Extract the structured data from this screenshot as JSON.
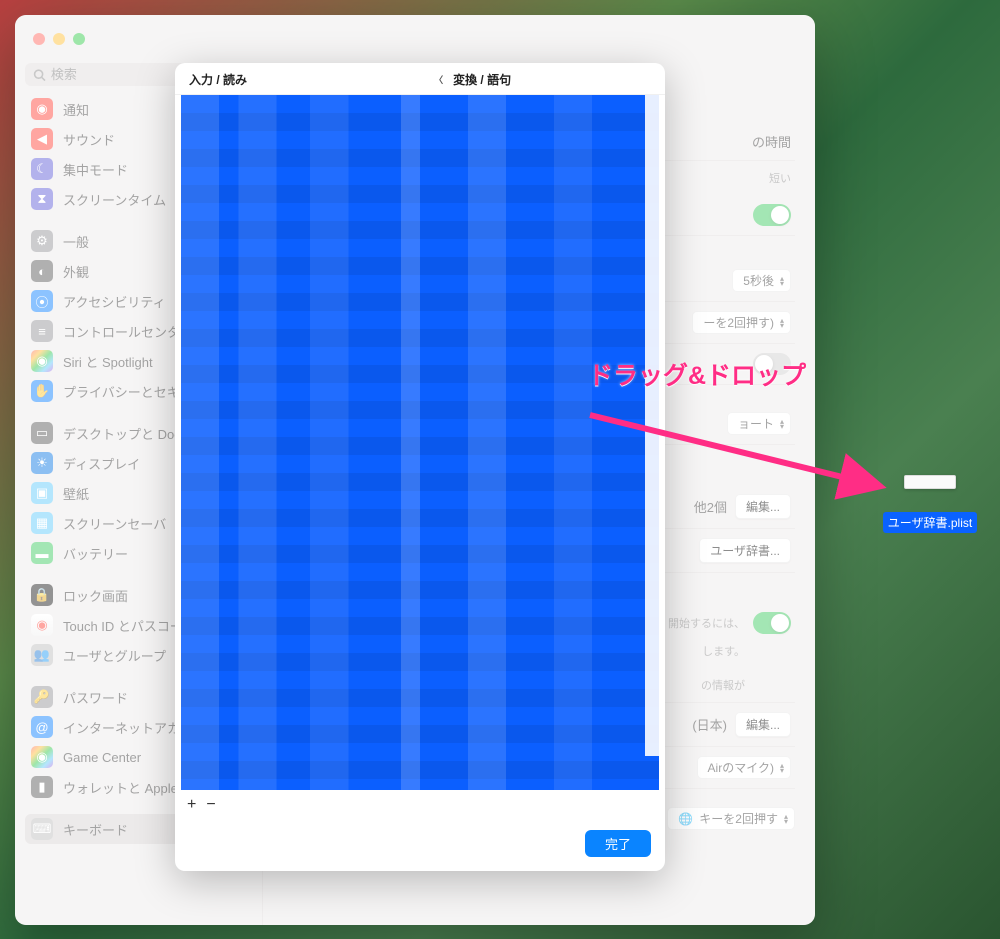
{
  "window": {
    "title": "キーボード",
    "search_placeholder": "検索"
  },
  "sidebar": {
    "items": [
      {
        "label": "通知",
        "iconClass": "i-red",
        "glyph": "bell"
      },
      {
        "label": "サウンド",
        "iconClass": "i-red",
        "glyph": "speaker"
      },
      {
        "label": "集中モード",
        "iconClass": "i-purple",
        "glyph": "moon"
      },
      {
        "label": "スクリーンタイム",
        "iconClass": "i-purple",
        "glyph": "hourglass"
      },
      {
        "spacer": true
      },
      {
        "label": "一般",
        "iconClass": "i-gray",
        "glyph": "gear"
      },
      {
        "label": "外観",
        "iconClass": "i-darkgray",
        "glyph": "contrast"
      },
      {
        "label": "アクセシビリティ",
        "iconClass": "i-blue",
        "glyph": "person"
      },
      {
        "label": "コントロールセンター",
        "iconClass": "i-gray",
        "glyph": "sliders"
      },
      {
        "label": "Siri と Spotlight",
        "iconClass": "i-rainbow",
        "glyph": "siri"
      },
      {
        "label": "プライバシーとセキュリティ",
        "iconClass": "i-blue",
        "glyph": "hand"
      },
      {
        "spacer": true
      },
      {
        "label": "デスクトップと Dock",
        "iconClass": "i-darkgray",
        "glyph": "dock"
      },
      {
        "label": "ディスプレイ",
        "iconClass": "i-displayblue",
        "glyph": "sun"
      },
      {
        "label": "壁紙",
        "iconClass": "i-cyan",
        "glyph": "photo"
      },
      {
        "label": "スクリーンセーバ",
        "iconClass": "i-cyan",
        "glyph": "screensaver"
      },
      {
        "label": "バッテリー",
        "iconClass": "i-green",
        "glyph": "battery"
      },
      {
        "spacer": true
      },
      {
        "label": "ロック画面",
        "iconClass": "i-black",
        "glyph": "lock"
      },
      {
        "label": "Touch ID とパスコード",
        "iconClass": "i-fp",
        "glyph": "fingerprint"
      },
      {
        "label": "ユーザとグループ",
        "iconClass": "i-btgray",
        "glyph": "users"
      },
      {
        "spacer": true
      },
      {
        "label": "パスワード",
        "iconClass": "i-gray",
        "glyph": "key"
      },
      {
        "label": "インターネットアカウント",
        "iconClass": "i-blue",
        "glyph": "at"
      },
      {
        "label": "Game Center",
        "iconClass": "i-rainbow",
        "glyph": "gamecenter"
      },
      {
        "label": "ウォレットと Apple Pay",
        "iconClass": "i-darkgray",
        "glyph": "wallet"
      },
      {
        "spacer": true
      },
      {
        "label": "キーボード",
        "iconClass": "i-btgray",
        "glyph": "keyboard",
        "selected": true
      }
    ]
  },
  "content": {
    "visible_labels": {
      "time_suffix": "の時間",
      "short": "短い",
      "delay_value": "5秒後",
      "press_twice_1": "ーを2回押す)",
      "shortcut": "ョート",
      "other_2": "他2個",
      "edit": "編集...",
      "user_dict": "ユーザ辞書...",
      "start_hint_1": "開始するには、",
      "start_hint_2": "します。",
      "info_suffix": "の情報が",
      "japan": "(日本)",
      "mic_hint": "Airのマイク)",
      "shortcuts_label": "ショートカット",
      "globe_press": "キーを2回押す"
    }
  },
  "sheet": {
    "col1": "入力 / 読み",
    "col2": "変換 / 語句",
    "add": "+",
    "remove": "−",
    "done": "完了"
  },
  "desktop_file": {
    "name": "ユーザ辞書.plist"
  },
  "annotation": {
    "text": "ドラッグ&ドロップ"
  }
}
